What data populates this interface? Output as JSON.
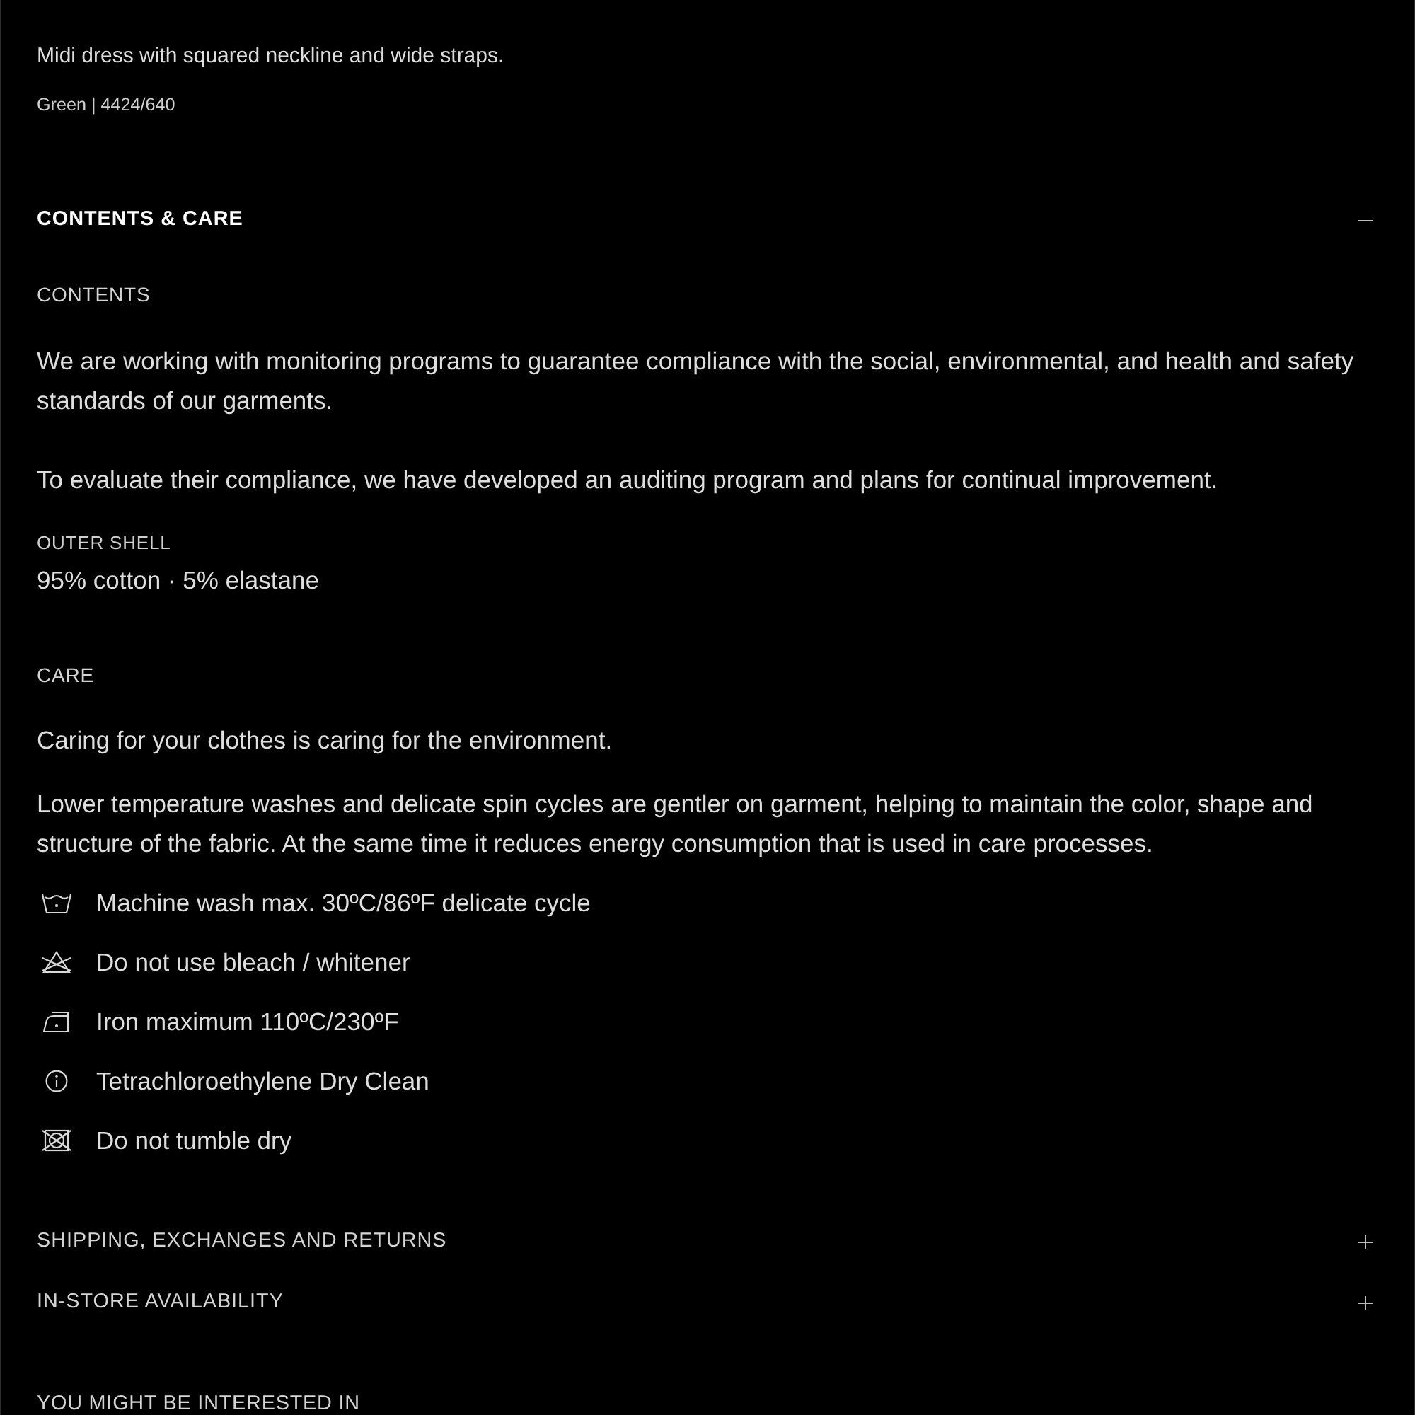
{
  "product": {
    "description": "Midi dress with squared neckline and wide straps.",
    "color_reference": "Green | 4424/640"
  },
  "sections": [
    {
      "title": "CONTENTS & CARE",
      "expanded": true,
      "blocks": [
        {
          "kind": "contents",
          "heading": "CONTENTS",
          "paragraphs": [
            "We are working with monitoring programs to guarantee compliance with the social, environmental, and health and safety standards of our garments.",
            "To evaluate their compliance, we have developed an auditing program and plans for continual improvement."
          ],
          "composition": [
            {
              "label": "OUTER SHELL",
              "value": "95% cotton · 5% elastane"
            }
          ]
        },
        {
          "kind": "care",
          "heading": "CARE",
          "paragraphs": [
            "Caring for your clothes is caring for the environment.",
            "Lower temperature washes and delicate spin cycles are gentler on garment, helping to maintain the color, shape and structure of the fabric. At the same time it reduces energy consumption that is used in care processes."
          ],
          "instructions": [
            {
              "kind": "wash",
              "text": "Machine wash max. 30ºC/86ºF delicate cycle"
            },
            {
              "kind": "no_bleach",
              "text": "Do not use bleach / whitener"
            },
            {
              "kind": "iron",
              "text": "Iron maximum 110ºC/230ºF"
            },
            {
              "kind": "dry_clean",
              "text": "Tetrachloroethylene Dry Clean"
            },
            {
              "kind": "no_tumble_dry",
              "text": "Do not tumble dry"
            }
          ]
        }
      ]
    },
    {
      "title": "SHIPPING, EXCHANGES AND RETURNS",
      "expanded": false
    },
    {
      "title": "IN-STORE AVAILABILITY",
      "expanded": false
    }
  ],
  "recommendations": {
    "heading": "YOU MIGHT BE INTERESTED IN"
  }
}
